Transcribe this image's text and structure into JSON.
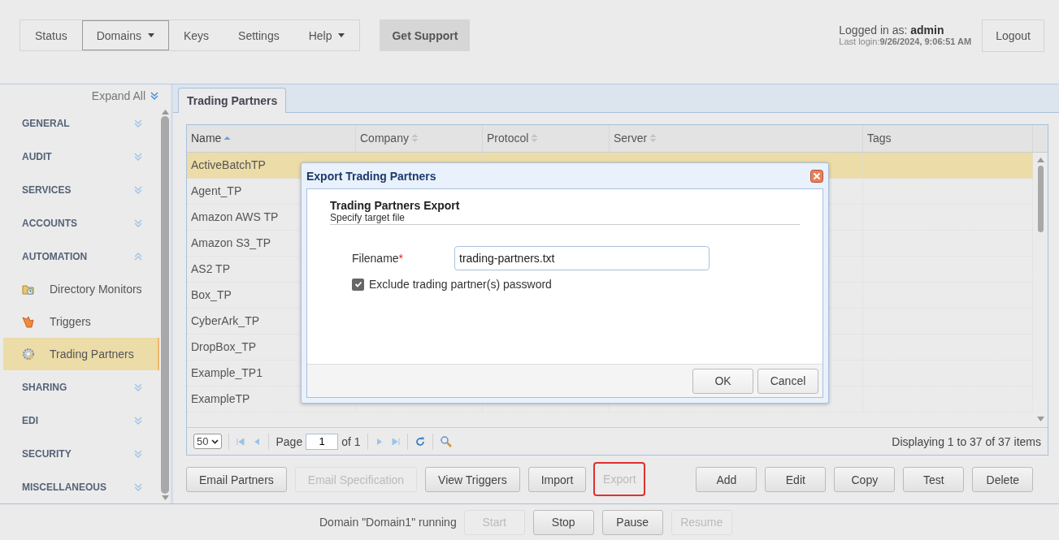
{
  "nav": {
    "items": [
      {
        "label": "Status",
        "selected": false,
        "dropdown": false
      },
      {
        "label": "Domains",
        "selected": true,
        "dropdown": true
      },
      {
        "label": "Keys",
        "selected": false,
        "dropdown": false
      },
      {
        "label": "Settings",
        "selected": false,
        "dropdown": false
      },
      {
        "label": "Help",
        "selected": false,
        "dropdown": true
      }
    ]
  },
  "support_button": "Get Support",
  "user": {
    "prefix": "Logged in as:",
    "name": "admin",
    "last_login": "Last login:**9/26/2024, 9:06:51 AM**"
  },
  "logout_button": "Logout",
  "sidebar": {
    "expand_all": "Expand All",
    "sections": [
      {
        "label": "GENERAL",
        "expanded": false
      },
      {
        "label": "AUDIT",
        "expanded": false
      },
      {
        "label": "SERVICES",
        "expanded": false
      },
      {
        "label": "ACCOUNTS",
        "expanded": false
      },
      {
        "label": "AUTOMATION",
        "expanded": true,
        "children": [
          {
            "label": "Directory Monitors",
            "kind": "folder",
            "selected": false
          },
          {
            "label": "Triggers",
            "kind": "trigger",
            "selected": false
          },
          {
            "label": "Trading Partners",
            "kind": "gear",
            "selected": true
          }
        ]
      },
      {
        "label": "SHARING",
        "expanded": false
      },
      {
        "label": "EDI",
        "expanded": false
      },
      {
        "label": "SECURITY",
        "expanded": false
      },
      {
        "label": "MISCELLANEOUS",
        "expanded": false
      }
    ]
  },
  "tabs": [
    {
      "label": "Trading Partners",
      "selected": true
    }
  ],
  "table": {
    "columns": [
      {
        "label": "Name",
        "sortable": true,
        "sorted": true
      },
      {
        "label": "Company",
        "sortable": true,
        "sorted": false
      },
      {
        "label": "Protocol",
        "sortable": true,
        "sorted": false
      },
      {
        "label": "Server",
        "sortable": true,
        "sorted": false
      },
      {
        "label": "Tags",
        "sortable": false,
        "sorted": false
      }
    ],
    "rows": [
      {
        "name": "ActiveBatchTP",
        "selected": true
      },
      {
        "name": "Agent_TP",
        "selected": false
      },
      {
        "name": "Amazon AWS TP",
        "selected": false
      },
      {
        "name": "Amazon S3_TP",
        "selected": false
      },
      {
        "name": "AS2 TP",
        "selected": false
      },
      {
        "name": "Box_TP",
        "selected": false
      },
      {
        "name": "CyberArk_TP",
        "selected": false
      },
      {
        "name": "DropBox_TP",
        "selected": false
      },
      {
        "name": "Example_TP1",
        "selected": false
      },
      {
        "name": "ExampleTP",
        "selected": false
      }
    ]
  },
  "pager": {
    "page_size": "50",
    "page_label": "Page",
    "page": "1",
    "of": "of 1",
    "summary": "Displaying 1 to 37 of 37 items"
  },
  "actions_left": [
    {
      "label": "Email Partners",
      "disabled": false,
      "highlighted": false
    },
    {
      "label": "Email Specification",
      "disabled": true,
      "highlighted": false
    },
    {
      "label": "View Triggers",
      "disabled": false,
      "highlighted": false
    },
    {
      "label": "Import",
      "disabled": false,
      "highlighted": false
    },
    {
      "label": "Export",
      "disabled": true,
      "highlighted": true
    }
  ],
  "actions_right": [
    {
      "label": "Add",
      "disabled": false
    },
    {
      "label": "Edit",
      "disabled": false
    },
    {
      "label": "Copy",
      "disabled": false
    },
    {
      "label": "Test",
      "disabled": false
    },
    {
      "label": "Delete",
      "disabled": false
    }
  ],
  "status_bar": {
    "text": "Domain \"Domain1\" running",
    "buttons": [
      {
        "label": "Start",
        "disabled": true
      },
      {
        "label": "Stop",
        "disabled": false
      },
      {
        "label": "Pause",
        "disabled": false
      },
      {
        "label": "Resume",
        "disabled": true
      }
    ]
  },
  "dialog": {
    "title": "Export Trading Partners",
    "heading": "Trading Partners Export",
    "subheading": "Specify target file",
    "field": {
      "label": "Filename",
      "required_mark": "*",
      "value": "trading-partners.txt"
    },
    "checkbox": {
      "label": "Exclude trading partner(s) password",
      "checked": true
    },
    "buttons": [
      "OK",
      "Cancel"
    ]
  }
}
